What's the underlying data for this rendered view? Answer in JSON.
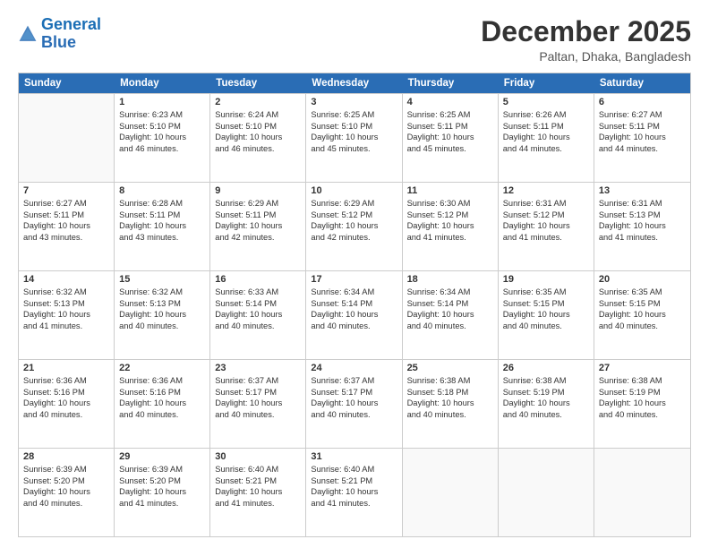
{
  "logo": {
    "text_general": "General",
    "text_blue": "Blue"
  },
  "header": {
    "title": "December 2025",
    "subtitle": "Paltan, Dhaka, Bangladesh"
  },
  "calendar": {
    "days_of_week": [
      "Sunday",
      "Monday",
      "Tuesday",
      "Wednesday",
      "Thursday",
      "Friday",
      "Saturday"
    ],
    "weeks": [
      [
        {
          "day": "",
          "empty": true
        },
        {
          "day": "1",
          "lines": [
            "Sunrise: 6:23 AM",
            "Sunset: 5:10 PM",
            "Daylight: 10 hours",
            "and 46 minutes."
          ]
        },
        {
          "day": "2",
          "lines": [
            "Sunrise: 6:24 AM",
            "Sunset: 5:10 PM",
            "Daylight: 10 hours",
            "and 46 minutes."
          ]
        },
        {
          "day": "3",
          "lines": [
            "Sunrise: 6:25 AM",
            "Sunset: 5:10 PM",
            "Daylight: 10 hours",
            "and 45 minutes."
          ]
        },
        {
          "day": "4",
          "lines": [
            "Sunrise: 6:25 AM",
            "Sunset: 5:11 PM",
            "Daylight: 10 hours",
            "and 45 minutes."
          ]
        },
        {
          "day": "5",
          "lines": [
            "Sunrise: 6:26 AM",
            "Sunset: 5:11 PM",
            "Daylight: 10 hours",
            "and 44 minutes."
          ]
        },
        {
          "day": "6",
          "lines": [
            "Sunrise: 6:27 AM",
            "Sunset: 5:11 PM",
            "Daylight: 10 hours",
            "and 44 minutes."
          ]
        }
      ],
      [
        {
          "day": "7",
          "lines": [
            "Sunrise: 6:27 AM",
            "Sunset: 5:11 PM",
            "Daylight: 10 hours",
            "and 43 minutes."
          ]
        },
        {
          "day": "8",
          "lines": [
            "Sunrise: 6:28 AM",
            "Sunset: 5:11 PM",
            "Daylight: 10 hours",
            "and 43 minutes."
          ]
        },
        {
          "day": "9",
          "lines": [
            "Sunrise: 6:29 AM",
            "Sunset: 5:11 PM",
            "Daylight: 10 hours",
            "and 42 minutes."
          ]
        },
        {
          "day": "10",
          "lines": [
            "Sunrise: 6:29 AM",
            "Sunset: 5:12 PM",
            "Daylight: 10 hours",
            "and 42 minutes."
          ]
        },
        {
          "day": "11",
          "lines": [
            "Sunrise: 6:30 AM",
            "Sunset: 5:12 PM",
            "Daylight: 10 hours",
            "and 41 minutes."
          ]
        },
        {
          "day": "12",
          "lines": [
            "Sunrise: 6:31 AM",
            "Sunset: 5:12 PM",
            "Daylight: 10 hours",
            "and 41 minutes."
          ]
        },
        {
          "day": "13",
          "lines": [
            "Sunrise: 6:31 AM",
            "Sunset: 5:13 PM",
            "Daylight: 10 hours",
            "and 41 minutes."
          ]
        }
      ],
      [
        {
          "day": "14",
          "lines": [
            "Sunrise: 6:32 AM",
            "Sunset: 5:13 PM",
            "Daylight: 10 hours",
            "and 41 minutes."
          ]
        },
        {
          "day": "15",
          "lines": [
            "Sunrise: 6:32 AM",
            "Sunset: 5:13 PM",
            "Daylight: 10 hours",
            "and 40 minutes."
          ]
        },
        {
          "day": "16",
          "lines": [
            "Sunrise: 6:33 AM",
            "Sunset: 5:14 PM",
            "Daylight: 10 hours",
            "and 40 minutes."
          ]
        },
        {
          "day": "17",
          "lines": [
            "Sunrise: 6:34 AM",
            "Sunset: 5:14 PM",
            "Daylight: 10 hours",
            "and 40 minutes."
          ]
        },
        {
          "day": "18",
          "lines": [
            "Sunrise: 6:34 AM",
            "Sunset: 5:14 PM",
            "Daylight: 10 hours",
            "and 40 minutes."
          ]
        },
        {
          "day": "19",
          "lines": [
            "Sunrise: 6:35 AM",
            "Sunset: 5:15 PM",
            "Daylight: 10 hours",
            "and 40 minutes."
          ]
        },
        {
          "day": "20",
          "lines": [
            "Sunrise: 6:35 AM",
            "Sunset: 5:15 PM",
            "Daylight: 10 hours",
            "and 40 minutes."
          ]
        }
      ],
      [
        {
          "day": "21",
          "lines": [
            "Sunrise: 6:36 AM",
            "Sunset: 5:16 PM",
            "Daylight: 10 hours",
            "and 40 minutes."
          ]
        },
        {
          "day": "22",
          "lines": [
            "Sunrise: 6:36 AM",
            "Sunset: 5:16 PM",
            "Daylight: 10 hours",
            "and 40 minutes."
          ]
        },
        {
          "day": "23",
          "lines": [
            "Sunrise: 6:37 AM",
            "Sunset: 5:17 PM",
            "Daylight: 10 hours",
            "and 40 minutes."
          ]
        },
        {
          "day": "24",
          "lines": [
            "Sunrise: 6:37 AM",
            "Sunset: 5:17 PM",
            "Daylight: 10 hours",
            "and 40 minutes."
          ]
        },
        {
          "day": "25",
          "lines": [
            "Sunrise: 6:38 AM",
            "Sunset: 5:18 PM",
            "Daylight: 10 hours",
            "and 40 minutes."
          ]
        },
        {
          "day": "26",
          "lines": [
            "Sunrise: 6:38 AM",
            "Sunset: 5:19 PM",
            "Daylight: 10 hours",
            "and 40 minutes."
          ]
        },
        {
          "day": "27",
          "lines": [
            "Sunrise: 6:38 AM",
            "Sunset: 5:19 PM",
            "Daylight: 10 hours",
            "and 40 minutes."
          ]
        }
      ],
      [
        {
          "day": "28",
          "lines": [
            "Sunrise: 6:39 AM",
            "Sunset: 5:20 PM",
            "Daylight: 10 hours",
            "and 40 minutes."
          ]
        },
        {
          "day": "29",
          "lines": [
            "Sunrise: 6:39 AM",
            "Sunset: 5:20 PM",
            "Daylight: 10 hours",
            "and 41 minutes."
          ]
        },
        {
          "day": "30",
          "lines": [
            "Sunrise: 6:40 AM",
            "Sunset: 5:21 PM",
            "Daylight: 10 hours",
            "and 41 minutes."
          ]
        },
        {
          "day": "31",
          "lines": [
            "Sunrise: 6:40 AM",
            "Sunset: 5:21 PM",
            "Daylight: 10 hours",
            "and 41 minutes."
          ]
        },
        {
          "day": "",
          "empty": true
        },
        {
          "day": "",
          "empty": true
        },
        {
          "day": "",
          "empty": true
        }
      ]
    ]
  }
}
